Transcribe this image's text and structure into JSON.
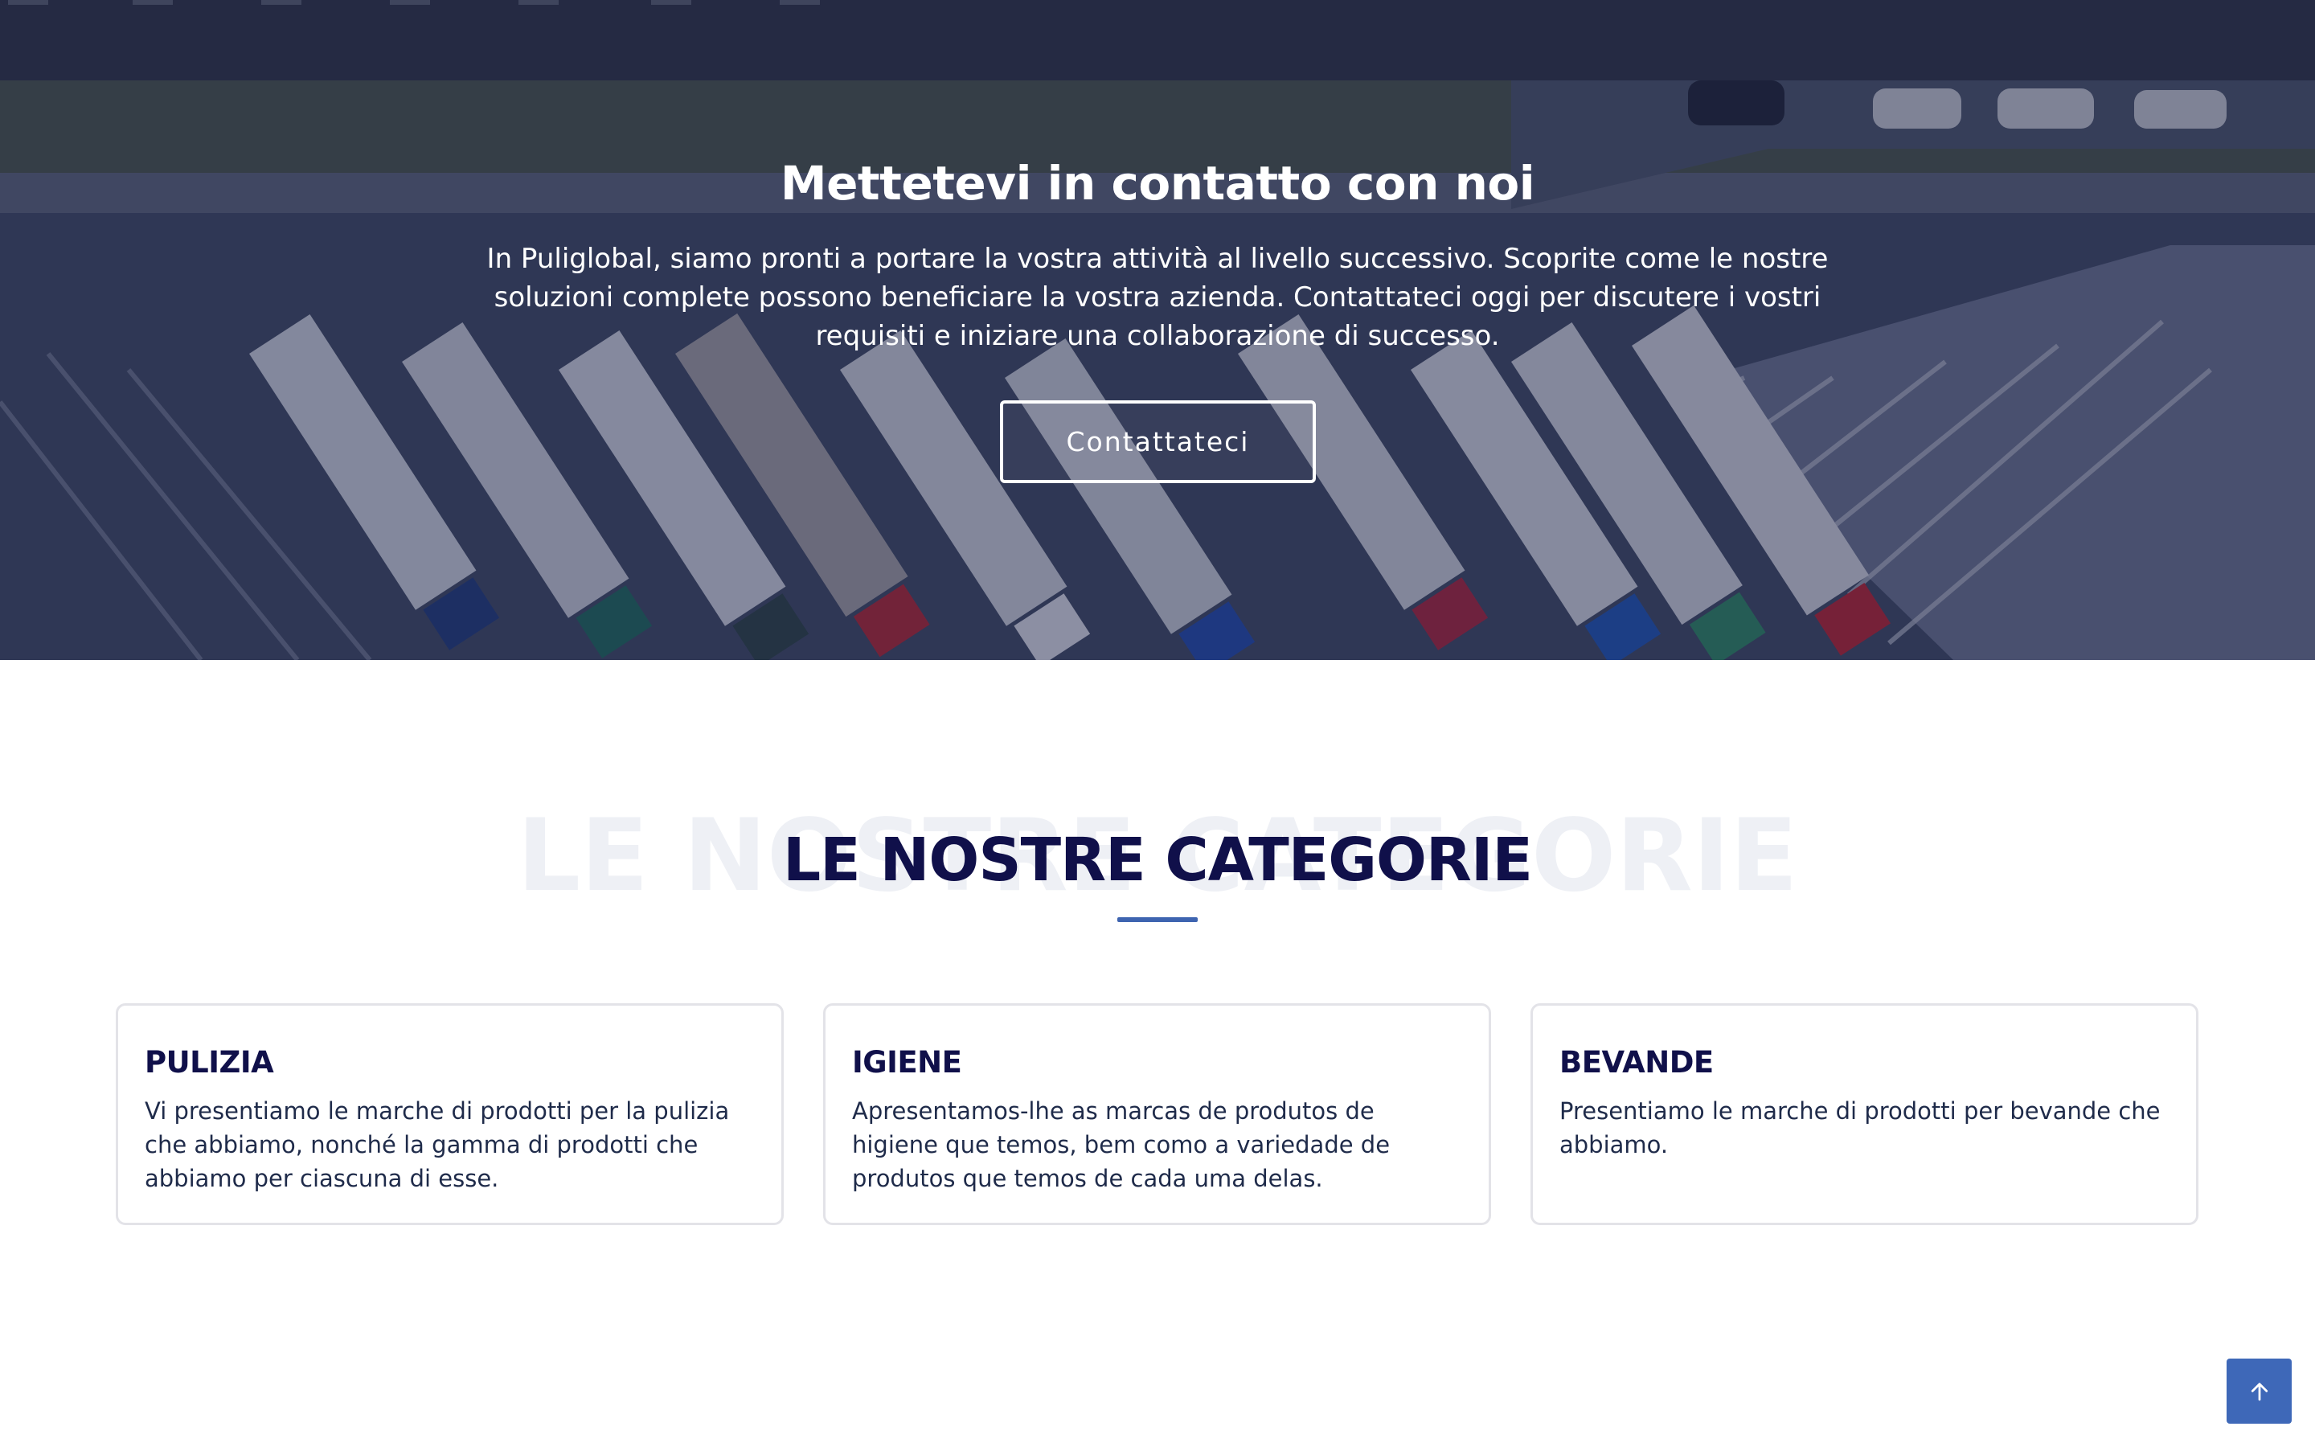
{
  "hero": {
    "title": "Mettetevi in contatto con noi",
    "text": "In Puliglobal, siamo pronti a portare la vostra attività al livello successivo. Scoprite come le nostre soluzioni complete possono beneficiare la vostra azienda. Contattateci oggi per discutere i vostri requisiti e iniziare una collaborazione di successo.",
    "button_label": "Contattateci",
    "background_image": "aerial-trucks-parking"
  },
  "categories": {
    "ghost_title": "LE NOSTRE CATEGORIE",
    "title": "LE NOSTRE CATEGORIE",
    "items": [
      {
        "title": "PULIZIA",
        "text": "Vi presentiamo le marche di prodotti per la pulizia che abbiamo, nonché la gamma di prodotti che abbiamo per ciascuna di esse."
      },
      {
        "title": "IGIENE",
        "text": "Apresentamos-lhe as marcas de produtos de higiene que temos, bem como a variedade de produtos que temos de cada uma delas."
      },
      {
        "title": "BEVANDE",
        "text": "Presentiamo le marche di prodotti per bevande che abbiamo."
      }
    ]
  },
  "scroll_top": {
    "icon": "arrow-up-icon"
  },
  "colors": {
    "heading": "#10104a",
    "accent": "#3e64b0",
    "button": "#3e68b8",
    "ghost": "#eef0f5"
  }
}
